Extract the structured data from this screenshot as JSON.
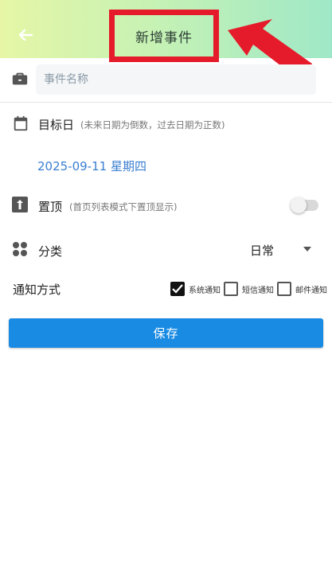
{
  "header": {
    "title": "新增事件"
  },
  "form": {
    "name": {
      "placeholder": "事件名称",
      "value": ""
    },
    "target_date": {
      "label": "目标日",
      "hint": "(未来日期为倒数，过去日期为正数)",
      "value": "2025-09-11 星期四"
    },
    "pin": {
      "label": "置顶",
      "hint": "(首页列表模式下置顶显示)",
      "enabled": false
    },
    "category": {
      "label": "分类",
      "selected": "日常"
    },
    "notify": {
      "label": "通知方式",
      "options": [
        {
          "label": "系统通知",
          "checked": true
        },
        {
          "label": "短信通知",
          "checked": false
        },
        {
          "label": "邮件通知",
          "checked": false
        }
      ]
    }
  },
  "actions": {
    "save_label": "保存"
  },
  "colors": {
    "annotation": "#e51a2a",
    "primary": "#1a8be3",
    "date_link": "#3b7fd1"
  }
}
